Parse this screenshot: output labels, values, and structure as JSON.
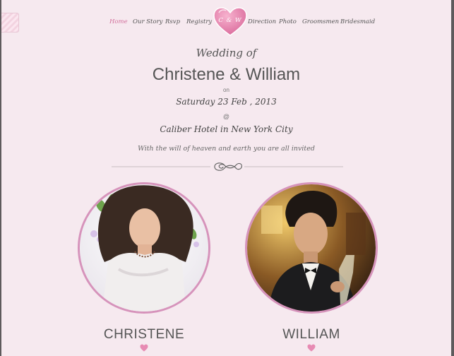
{
  "nav": {
    "items": [
      "Home",
      "Our Story",
      "Rsvp",
      "Registry",
      "Direction",
      "Photo",
      "Groomsmen",
      "Bridesmaid"
    ],
    "active": "Home",
    "logo_text": "C & W"
  },
  "hero": {
    "heading": "Wedding of",
    "couple": "Christene & William",
    "on": "on",
    "date": "Saturday 23 Feb , 2013",
    "at": "@",
    "venue": "Caliber Hotel in New York City",
    "invite": "With the will of heaven and earth you are all invited"
  },
  "people": {
    "bride_name": "CHRISTENE",
    "groom_name": "WILLIAM"
  },
  "colors": {
    "background": "#f6e9ef",
    "accent_pink": "#d2709c",
    "portrait_border": "#d693bb",
    "text": "#555555"
  }
}
